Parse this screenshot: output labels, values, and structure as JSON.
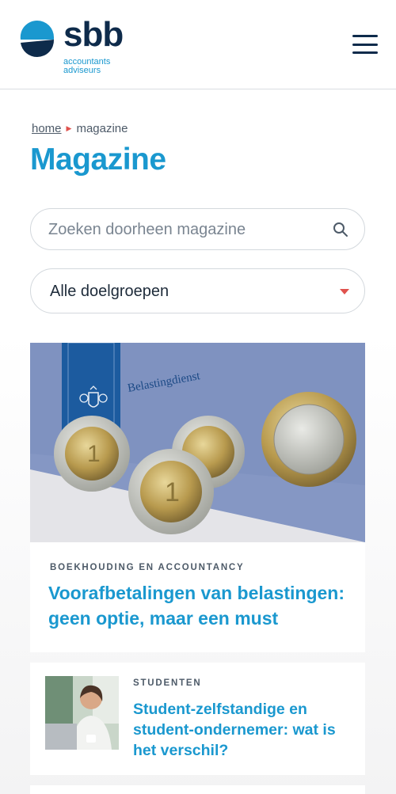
{
  "header": {
    "logo_word": "sbb",
    "logo_sub_1": "accountants",
    "logo_sub_2": "adviseurs",
    "menu_icon": "hamburger-icon"
  },
  "breadcrumb": {
    "home": "home",
    "current": "magazine"
  },
  "page_title": "Magazine",
  "search": {
    "placeholder": "Zoeken doorheen magazine",
    "icon": "search-icon"
  },
  "filter": {
    "selected": "Alle doelgroepen",
    "icon": "caret-down-icon"
  },
  "articles": [
    {
      "category": "BOEKHOUDING EN ACCOUNTANCY",
      "title": "Voorafbetalingen van belastingen: geen optie, maar een must",
      "image_text": "Belastingdienst"
    },
    {
      "category": "STUDENTEN",
      "title": "Student-zelfstandige en student-ondernemer: wat is het verschil?"
    }
  ],
  "colors": {
    "accent": "#1a98cf",
    "navy": "#0e2b4b",
    "marker": "#e0524d"
  }
}
